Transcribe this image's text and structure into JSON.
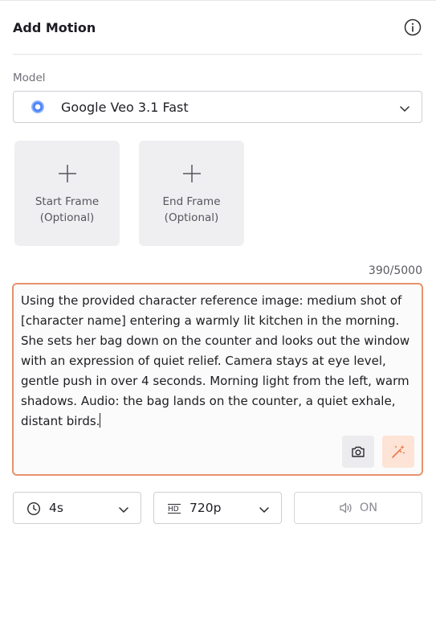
{
  "header": {
    "title": "Add Motion",
    "info_icon": "info-circle-icon"
  },
  "model": {
    "label": "Model",
    "selected": "Google Veo 3.1 Fast",
    "icon": "veo-model-icon"
  },
  "frames": [
    {
      "line1": "Start Frame",
      "line2": "(Optional)"
    },
    {
      "line1": "End Frame",
      "line2": "(Optional)"
    }
  ],
  "prompt": {
    "counter": "390/5000",
    "text": "Using the provided character reference image: medium shot of [character name] entering a warmly lit kitchen in the morning. She sets her bag down on the counter and looks out the window with an expression of quiet relief. Camera stays at eye level, gentle push in over 4 seconds. Morning light from the left, warm shadows. Audio: the bag lands on the counter, a quiet exhale, distant birds."
  },
  "options": {
    "duration": {
      "value": "4s",
      "icon": "clock-icon"
    },
    "resolution": {
      "value": "720p",
      "icon": "hd-icon"
    },
    "audio": {
      "label": "ON",
      "icon": "speaker-icon"
    }
  },
  "colors": {
    "accent": "#e8926d",
    "accent_soft": "#fde4d6",
    "card_bg": "#efeff1",
    "border": "#cfcfd4"
  }
}
